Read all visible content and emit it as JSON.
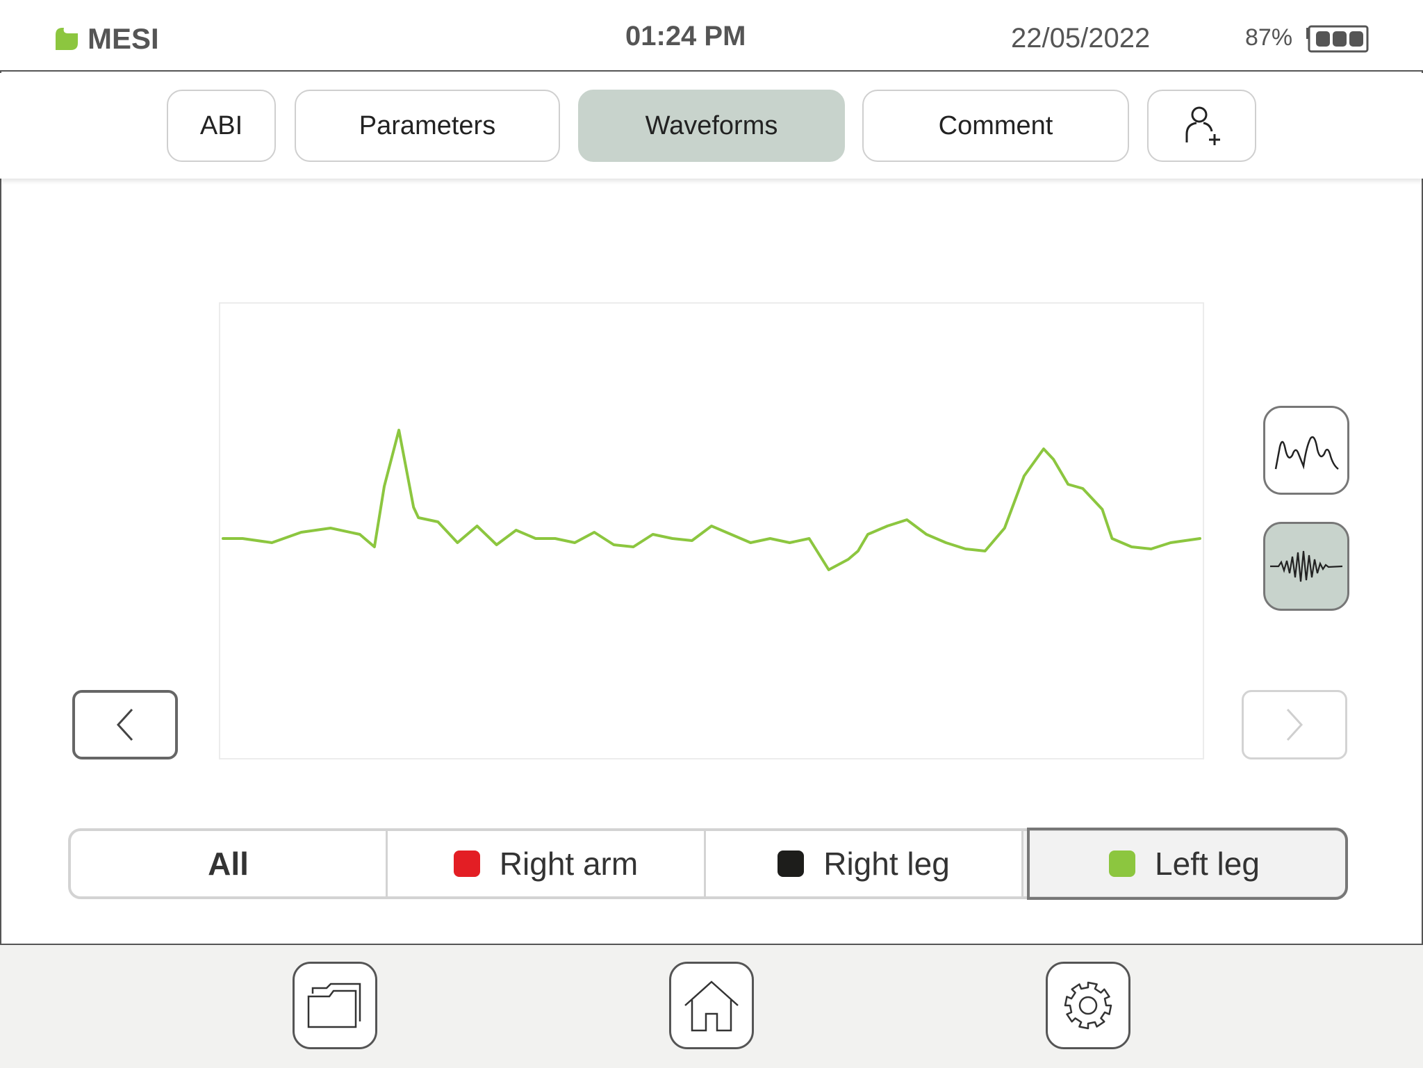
{
  "status_bar": {
    "brand": "MESI",
    "time": "01:24 PM",
    "date": "22/05/2022",
    "battery_percent": "87%",
    "battery_level": 0.87,
    "brand_color": "#8cc63f"
  },
  "tabs": [
    {
      "label": "ABI",
      "active": false
    },
    {
      "label": "Parameters",
      "active": false
    },
    {
      "label": "Waveforms",
      "active": true
    },
    {
      "label": "Comment",
      "active": false
    },
    {
      "icon": "add-patient-icon",
      "active": false
    }
  ],
  "waveform_view": {
    "modes": [
      {
        "icon": "pulse-waveform-icon",
        "active": false
      },
      {
        "icon": "raw-signal-icon",
        "active": true
      }
    ],
    "nav": {
      "prev_icon": "chevron-left-icon",
      "next_icon": "chevron-right-icon",
      "next_enabled": false
    }
  },
  "limbs": [
    {
      "label": "All",
      "color": null,
      "active": false
    },
    {
      "label": "Right arm",
      "color": "#e31e24",
      "active": false
    },
    {
      "label": "Right leg",
      "color": "#1d1d1b",
      "active": false
    },
    {
      "label": "Left leg",
      "color": "#8cc63f",
      "active": true
    }
  ],
  "bottom_nav": [
    {
      "icon": "folder-icon"
    },
    {
      "icon": "home-icon"
    },
    {
      "icon": "gear-icon"
    }
  ],
  "chart_data": {
    "type": "line",
    "title": "",
    "xlabel": "",
    "ylabel": "",
    "grid": false,
    "x": [
      0,
      0.02,
      0.05,
      0.08,
      0.11,
      0.14,
      0.155,
      0.165,
      0.18,
      0.195,
      0.2,
      0.22,
      0.24,
      0.26,
      0.28,
      0.3,
      0.32,
      0.34,
      0.36,
      0.38,
      0.4,
      0.42,
      0.44,
      0.46,
      0.48,
      0.5,
      0.52,
      0.54,
      0.56,
      0.58,
      0.6,
      0.62,
      0.64,
      0.65,
      0.66,
      0.68,
      0.7,
      0.72,
      0.74,
      0.76,
      0.78,
      0.8,
      0.82,
      0.84,
      0.85,
      0.865,
      0.88,
      0.9,
      0.91,
      0.92,
      0.93,
      0.95,
      0.97,
      1.0
    ],
    "series": [
      {
        "color": "#8cc63f",
        "values": [
          0.0,
          0.0,
          -0.02,
          0.03,
          0.05,
          0.02,
          -0.04,
          0.25,
          0.52,
          0.15,
          0.1,
          0.08,
          -0.02,
          0.06,
          -0.03,
          0.04,
          0.0,
          0.0,
          -0.02,
          0.03,
          -0.03,
          -0.04,
          0.02,
          0.0,
          -0.01,
          0.06,
          0.02,
          -0.02,
          0.0,
          -0.02,
          0.0,
          -0.15,
          -0.1,
          -0.06,
          0.02,
          0.06,
          0.09,
          0.02,
          -0.02,
          -0.05,
          -0.06,
          0.05,
          0.3,
          0.43,
          0.38,
          0.26,
          0.24,
          0.14,
          0.0,
          -0.02,
          -0.04,
          -0.05,
          -0.02,
          0.0
        ]
      }
    ],
    "ylim": [
      -1,
      1
    ]
  }
}
